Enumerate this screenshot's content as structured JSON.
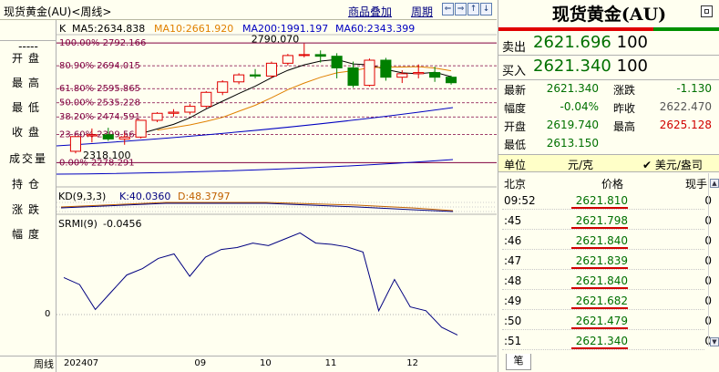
{
  "titlebar": {
    "title": "现货黄金(AU)<周线>",
    "overlay_link": "商品叠加",
    "period_link": "周期",
    "nav_prev": "⇐",
    "nav_next": "⇒",
    "nav_up": "↑",
    "nav_down": "↓"
  },
  "left_panel": {
    "dashes": "-----",
    "labels": [
      "开盘",
      "最高",
      "最低",
      "收盘",
      "成交量",
      "持仓",
      "涨跌",
      "幅度"
    ],
    "footer": "周线"
  },
  "main_chart": {
    "label": "K",
    "ma5": "MA5:2634.838",
    "ma10": "MA10:2661.920",
    "ma200": "MA200:1991.197",
    "ma60": "MA60:2343.399",
    "ma5_color": "#000000",
    "ma10_color": "#e08000",
    "ma200_color": "#0000c0",
    "ma60_color": "#0000c0",
    "high_label": "2790.070",
    "low_label": "2318.100",
    "fib_color": "#800040",
    "fib": [
      {
        "label": "100.00% 2792.166",
        "value": 2792.166
      },
      {
        "label": "80.90% 2694.015",
        "value": 2694.015
      },
      {
        "label": "61.80% 2595.865",
        "value": 2595.865
      },
      {
        "label": "50.00% 2535.228",
        "value": 2535.228
      },
      {
        "label": "38.20% 2474.591",
        "value": 2474.591
      },
      {
        "label": "23.60% 2399.565",
        "value": 2399.565
      },
      {
        "label": "0.00% 2278.291",
        "value": 2278.291
      }
    ],
    "candles": [
      {
        "o": 2327,
        "h": 2370,
        "l": 2318.1,
        "c": 2390
      },
      {
        "o": 2393,
        "h": 2425,
        "l": 2365,
        "c": 2398
      },
      {
        "o": 2398,
        "h": 2428,
        "l": 2372,
        "c": 2380
      },
      {
        "o": 2380,
        "h": 2405,
        "l": 2355,
        "c": 2388
      },
      {
        "o": 2388,
        "h": 2462,
        "l": 2382,
        "c": 2460
      },
      {
        "o": 2460,
        "h": 2495,
        "l": 2452,
        "c": 2490
      },
      {
        "o": 2490,
        "h": 2508,
        "l": 2475,
        "c": 2495
      },
      {
        "o": 2495,
        "h": 2530,
        "l": 2485,
        "c": 2520
      },
      {
        "o": 2520,
        "h": 2585,
        "l": 2512,
        "c": 2580
      },
      {
        "o": 2580,
        "h": 2632,
        "l": 2568,
        "c": 2625
      },
      {
        "o": 2625,
        "h": 2662,
        "l": 2615,
        "c": 2655
      },
      {
        "o": 2655,
        "h": 2680,
        "l": 2640,
        "c": 2650
      },
      {
        "o": 2650,
        "h": 2712,
        "l": 2640,
        "c": 2705
      },
      {
        "o": 2705,
        "h": 2745,
        "l": 2695,
        "c": 2738
      },
      {
        "o": 2738,
        "h": 2790.07,
        "l": 2730,
        "c": 2742
      },
      {
        "o": 2742,
        "h": 2760,
        "l": 2708,
        "c": 2735
      },
      {
        "o": 2735,
        "h": 2748,
        "l": 2640,
        "c": 2685
      },
      {
        "o": 2685,
        "h": 2712,
        "l": 2600,
        "c": 2610
      },
      {
        "o": 2610,
        "h": 2725,
        "l": 2605,
        "c": 2718
      },
      {
        "o": 2718,
        "h": 2728,
        "l": 2630,
        "c": 2645
      },
      {
        "o": 2645,
        "h": 2675,
        "l": 2620,
        "c": 2660
      },
      {
        "o": 2660,
        "h": 2700,
        "l": 2640,
        "c": 2665
      },
      {
        "o": 2665,
        "h": 2690,
        "l": 2625,
        "c": 2645
      },
      {
        "o": 2645,
        "h": 2652,
        "l": 2613.15,
        "c": 2621.34
      }
    ]
  },
  "kd": {
    "label": "KD(9,3,3)",
    "k_text": "K:40.0360",
    "d_text": "D:48.3797",
    "k_color": "#000080",
    "d_color": "#c06000"
  },
  "srmi": {
    "label": "SRMI(9)",
    "value_text": "-0.0456",
    "axis_zero": "0",
    "values": [
      0.58,
      0.47,
      0.08,
      0.35,
      0.62,
      0.72,
      0.88,
      0.95,
      0.6,
      0.9,
      1.02,
      1.05,
      1.12,
      1.08,
      1.18,
      1.28,
      1.12,
      1.1,
      1.06,
      0.98,
      0.06,
      0.55,
      0.12,
      0.06,
      -0.2,
      -0.32
    ]
  },
  "date_axis": {
    "ticks": [
      {
        "label": "202407",
        "pos": 0
      },
      {
        "label": "09",
        "pos": 8
      },
      {
        "label": "10",
        "pos": 12
      },
      {
        "label": "11",
        "pos": 16
      },
      {
        "label": "12",
        "pos": 21
      }
    ]
  },
  "quote": {
    "title": "现货黄金(AU)",
    "sell_label": "卖出",
    "sell_price": "2621.696",
    "sell_vol": "100",
    "buy_label": "买入",
    "buy_price": "2621.340",
    "buy_vol": "100",
    "stats": [
      {
        "l1": "最新",
        "v1": "2621.340",
        "c1": "green",
        "l2": "涨跌",
        "v2": "-1.130",
        "c2": "green"
      },
      {
        "l1": "幅度",
        "v1": "-0.04%",
        "c1": "green",
        "l2": "昨收",
        "v2": "2622.470",
        "c2": "grey"
      },
      {
        "l1": "开盘",
        "v1": "2619.740",
        "c1": "green",
        "l2": "最高",
        "v2": "2625.128",
        "c2": "red"
      },
      {
        "l1": "最低",
        "v1": "2613.150",
        "c1": "green",
        "l2": "",
        "v2": "",
        "c2": "green"
      }
    ],
    "unit_label": "单位",
    "unit_value": "元/克",
    "currency_label": "✔ 美元/盎司",
    "ticks_header": {
      "location": "北京",
      "price": "价格",
      "hand": "现手"
    },
    "ticks": [
      {
        "time": "09:52",
        "price": "2621.810",
        "hand": "0"
      },
      {
        "time": ":45",
        "price": "2621.798",
        "hand": "0"
      },
      {
        "time": ":46",
        "price": "2621.840",
        "hand": "0"
      },
      {
        "time": ":47",
        "price": "2621.839",
        "hand": "0"
      },
      {
        "time": ":48",
        "price": "2621.840",
        "hand": "0"
      },
      {
        "time": ":49",
        "price": "2621.682",
        "hand": "0"
      },
      {
        "time": ":50",
        "price": "2621.479",
        "hand": "0"
      },
      {
        "time": ":51",
        "price": "2621.340",
        "hand": "0"
      }
    ],
    "footer_tab": "笔"
  }
}
